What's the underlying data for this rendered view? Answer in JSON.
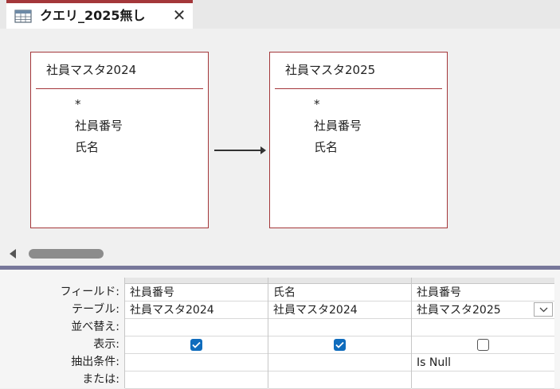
{
  "tab": {
    "title": "クエリ_2025無し",
    "close_glyph": "✕",
    "icon": "query-design-icon"
  },
  "tables": [
    {
      "title": "社員マスタ2024",
      "fields": [
        "*",
        "社員番号",
        "氏名"
      ]
    },
    {
      "title": "社員マスタ2025",
      "fields": [
        "*",
        "社員番号",
        "氏名"
      ]
    }
  ],
  "qbe": {
    "row_labels": [
      "フィールド:",
      "テーブル:",
      "並べ替え:",
      "表示:",
      "抽出条件:",
      "または:"
    ],
    "columns": [
      {
        "field": "社員番号",
        "table": "社員マスタ2024",
        "sort": "",
        "show": true,
        "criteria": "",
        "or": ""
      },
      {
        "field": "氏名",
        "table": "社員マスタ2024",
        "sort": "",
        "show": true,
        "criteria": "",
        "or": ""
      },
      {
        "field": "社員番号",
        "table": "社員マスタ2025",
        "sort": "",
        "show": false,
        "criteria": "Is Null",
        "or": ""
      }
    ]
  },
  "colors": {
    "accent": "#a4373a",
    "checkbox": "#0f6cbd",
    "splitter": "#77779a"
  }
}
